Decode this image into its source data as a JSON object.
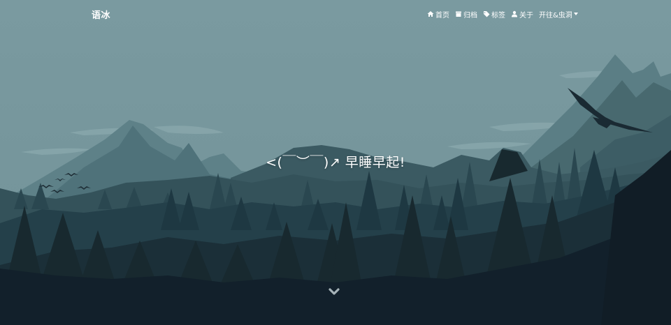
{
  "brand": {
    "title": "语冰"
  },
  "nav": {
    "items": [
      {
        "icon": "home-icon",
        "label": "首页"
      },
      {
        "icon": "archive-icon",
        "label": "归档"
      },
      {
        "icon": "tag-icon",
        "label": "标签"
      },
      {
        "icon": "user-icon",
        "label": "关于"
      },
      {
        "icon": "chevron-down-icon",
        "label": "开往&虫洞"
      }
    ]
  },
  "hero": {
    "motto": "<(￣︶￣)↗ 早睡早起!",
    "scroll_icon": "chevron-down-icon"
  },
  "colors": {
    "sky": "#7a9aa0",
    "mountain_far": "#587d83",
    "mountain_mid": "#3e6068",
    "forest_mid": "#2b4750",
    "forest_dark": "#1d313b",
    "forest_front": "#12202b",
    "text": "#ffffff"
  }
}
